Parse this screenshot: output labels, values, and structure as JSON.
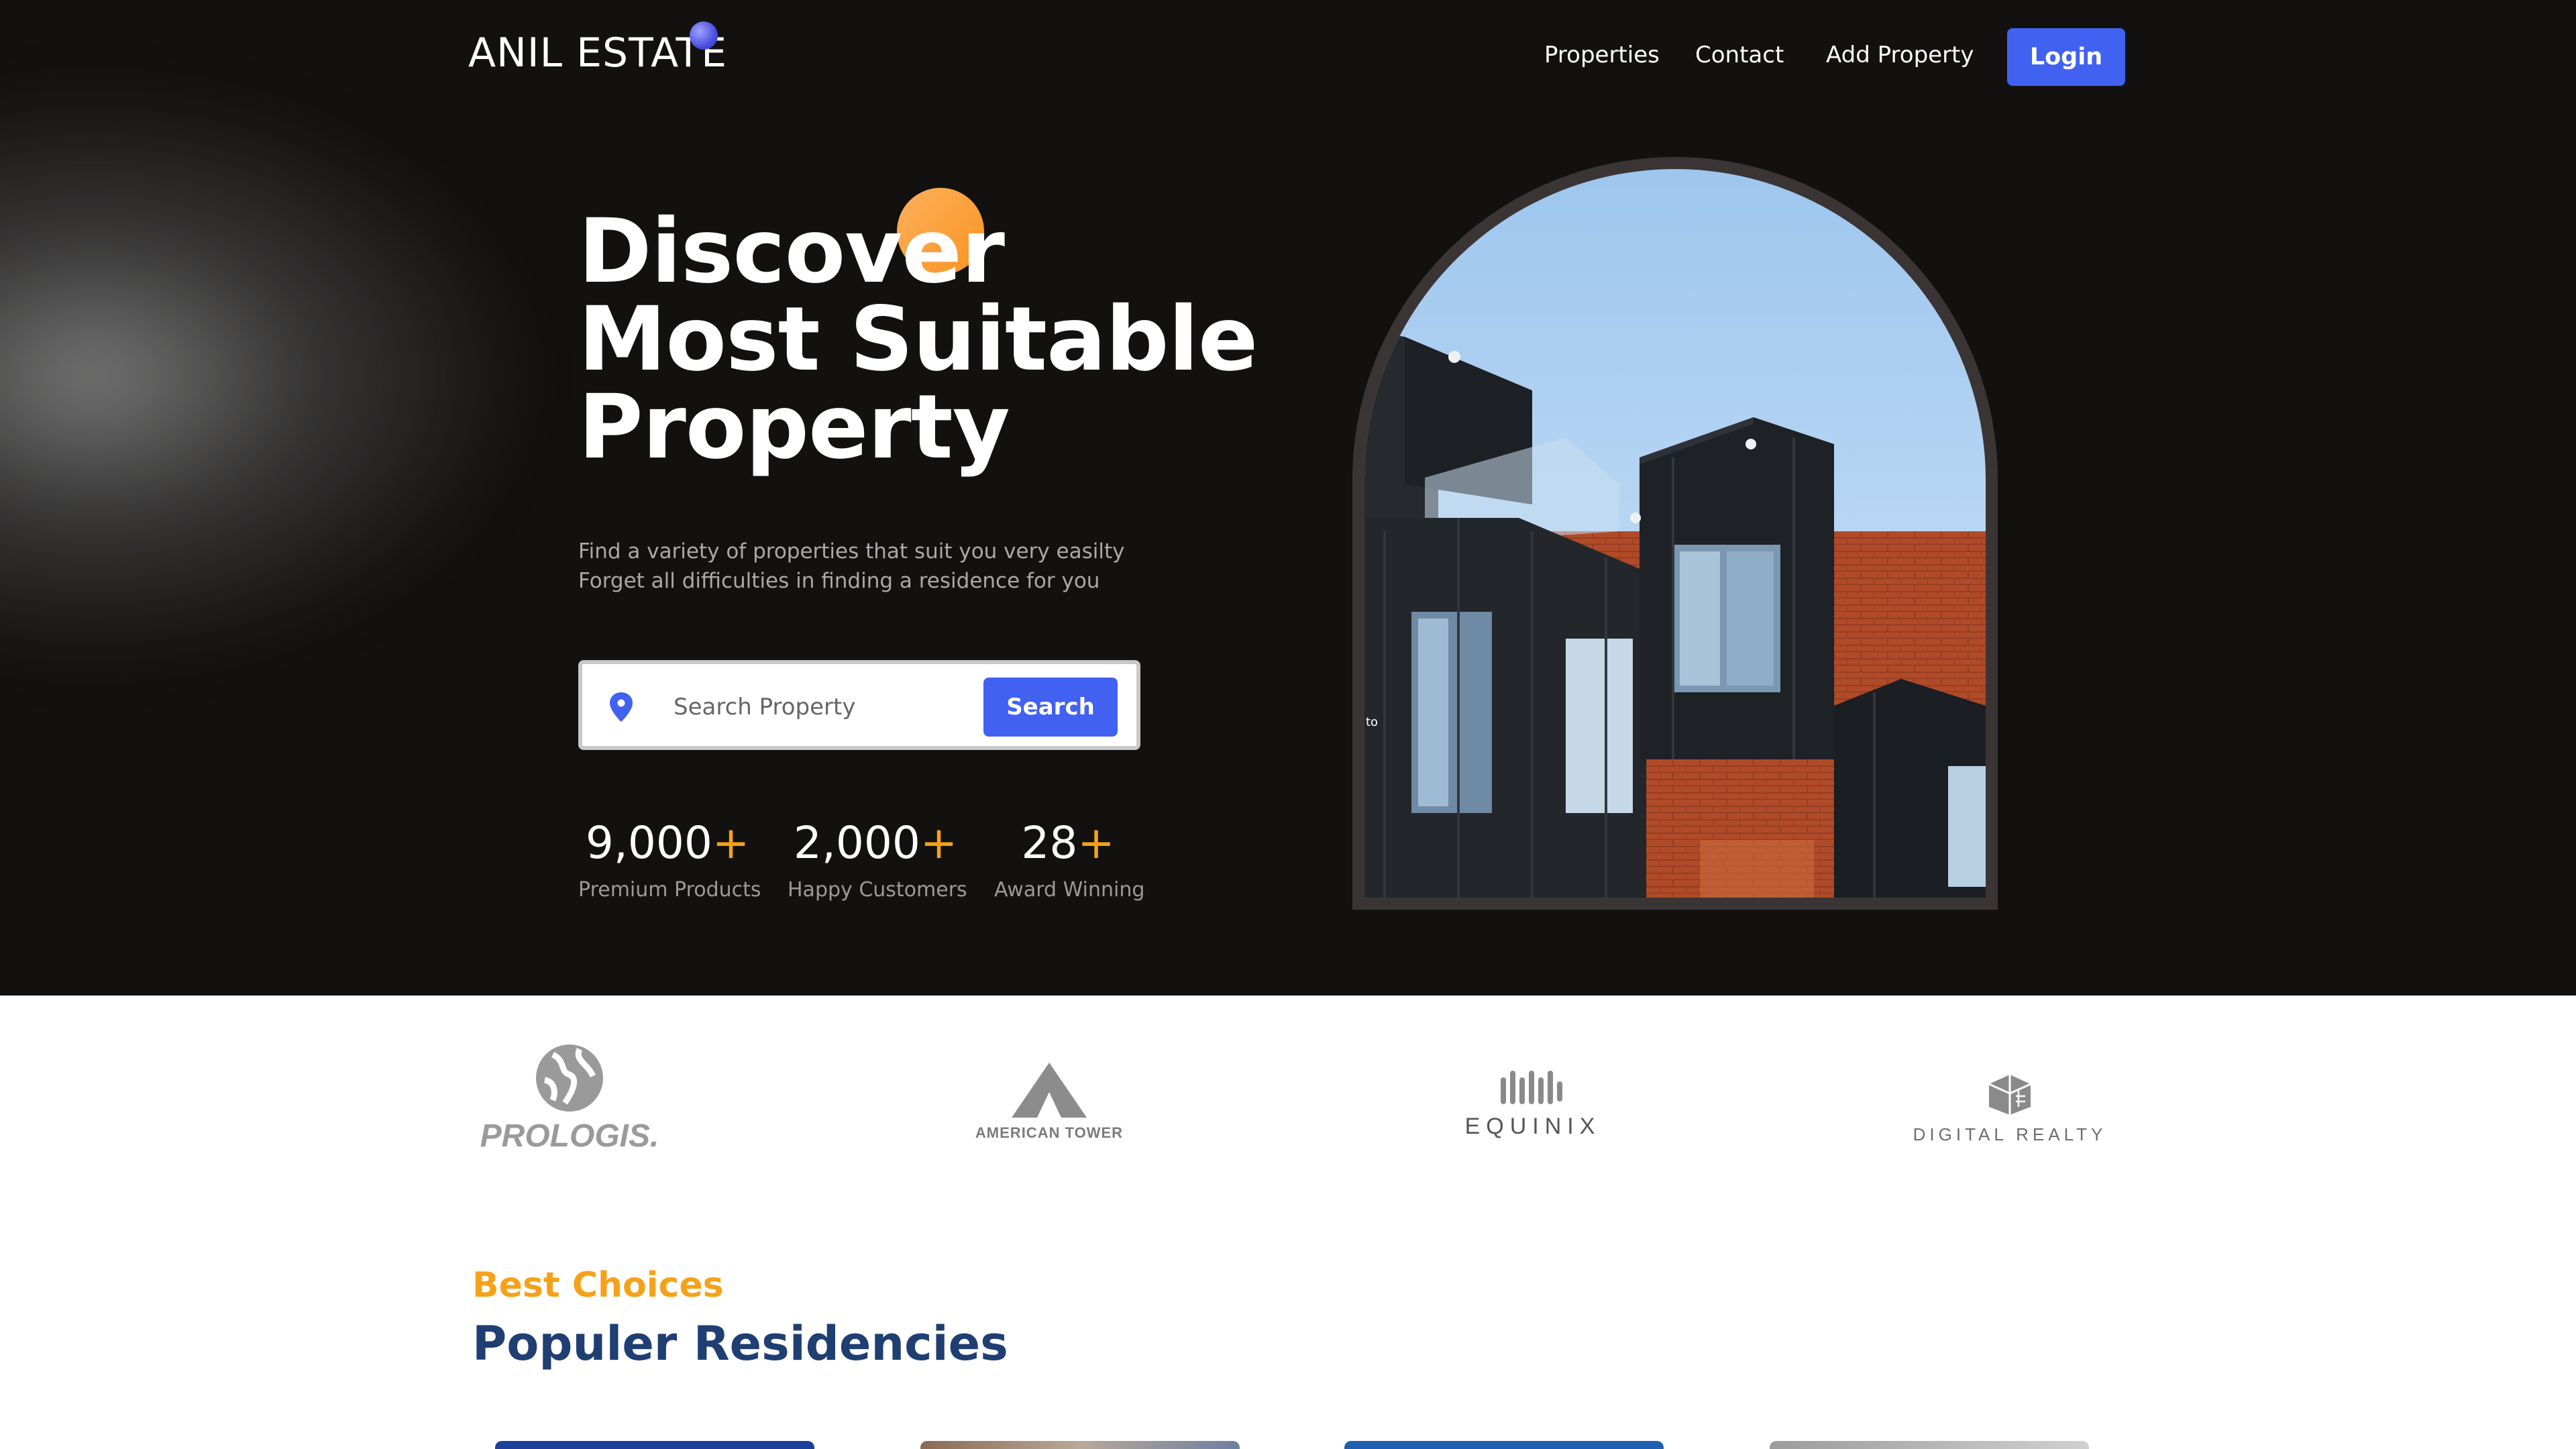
{
  "header": {
    "brand": "ANIL ESTATE",
    "nav": [
      "Properties",
      "Contact",
      "Add Property"
    ],
    "login_label": "Login"
  },
  "hero": {
    "headline": [
      "Discover",
      "Most Suitable",
      "Property"
    ],
    "subtext": [
      "Find a variety of properties that suit you very easilty",
      "Forget all difficulties in finding a residence for you"
    ],
    "search": {
      "placeholder": "Search Property",
      "button_label": "Search"
    },
    "stats": [
      {
        "value": "9,000",
        "suffix": "+",
        "label": "Premium Products"
      },
      {
        "value": "2,000",
        "suffix": "+",
        "label": "Happy Customers"
      },
      {
        "value": "28",
        "suffix": "+",
        "label": "Award Winning"
      }
    ],
    "image_caption": "to"
  },
  "partners": [
    "PROLOGIS.",
    "AMERICAN TOWER",
    "EQUINIX",
    "DIGITAL REALTY"
  ],
  "residencies": {
    "eyebrow": "Best Choices",
    "title": "Populer Residencies"
  },
  "colors": {
    "hero_bg": "#131110",
    "accent_blue": "#4161f0",
    "accent_orange": "#f5a21a",
    "title_navy": "#1f3e72"
  }
}
